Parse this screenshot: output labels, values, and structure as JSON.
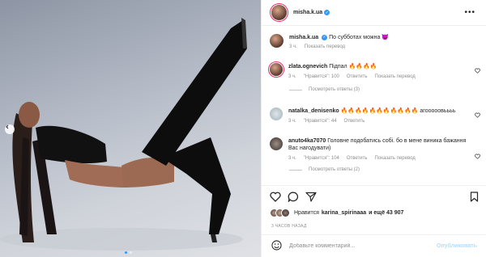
{
  "post": {
    "author": {
      "username": "misha.k.ua",
      "verified": true
    },
    "caption": {
      "text": "По субботах можна",
      "emoji": "😈",
      "time": "3 ч.",
      "translate": "Показать перевод"
    },
    "comments": [
      {
        "username": "zlata.ognevich",
        "text": "Підпал 🔥🔥🔥🔥",
        "time": "3 ч.",
        "likes": "\"Нравится\": 100",
        "reply": "Ответить",
        "translate": "Показать перевод",
        "replies": "Посмотреть ответы (3)"
      },
      {
        "username": "natalka_denisenko",
        "text": "🔥🔥🔥🔥🔥🔥🔥🔥🔥🔥🔥 агооооовьььь",
        "time": "3 ч.",
        "likes": "\"Нравится\": 44",
        "reply": "Ответить"
      },
      {
        "username": "anuto4ka7070",
        "text": "Головне подобатись собі. бо в мене виника бажання Вас нагодувати)",
        "time": "3 ч.",
        "likes": "\"Нравится\": 104",
        "reply": "Ответить",
        "translate": "Показать перевод",
        "replies": "Посмотреть ответы (2)"
      }
    ],
    "likes_text_prefix": "Нравится",
    "likes_user": "karina_spirinaaa",
    "likes_suffix": "и ещё 43 907",
    "posted_ago": "3 ЧАСОВ НАЗАД",
    "comment_placeholder": "Добавьте комментарий...",
    "publish_label": "Опубликовать"
  },
  "icons": {
    "more": "more-options-icon",
    "like": "heart-icon",
    "comment": "comment-icon",
    "share": "share-icon",
    "save": "bookmark-icon",
    "emoji": "emoji-icon",
    "prev": "chevron-left-icon"
  },
  "colors": {
    "accent": "#3897f0",
    "publish": "#b2dffc",
    "muted": "#8e8e8e"
  }
}
